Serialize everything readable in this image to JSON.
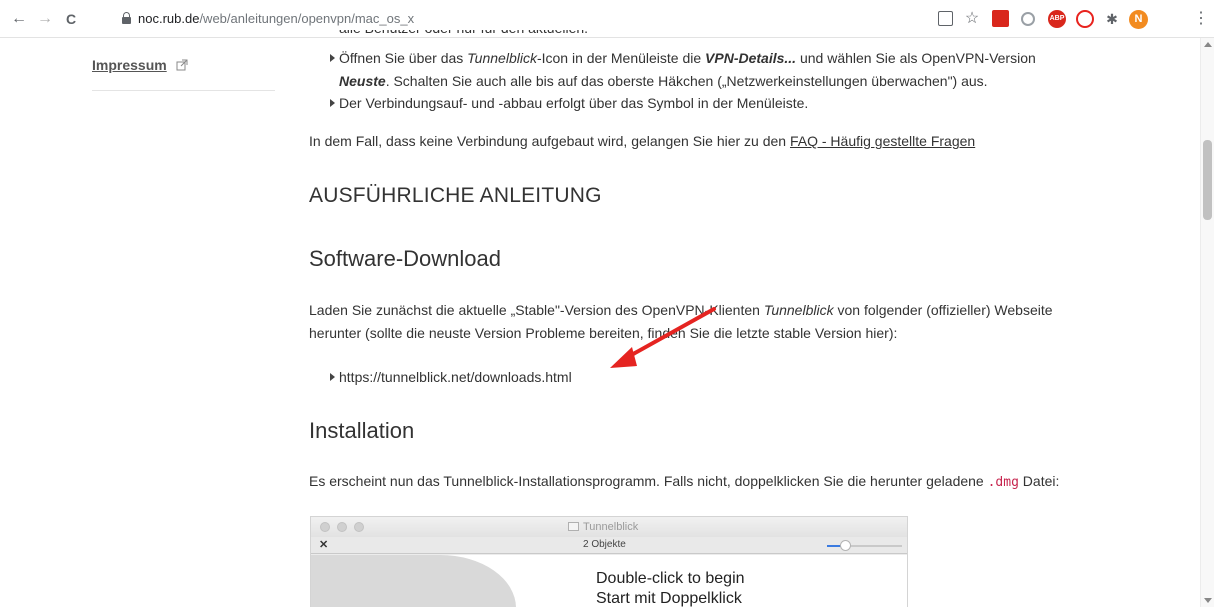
{
  "browser": {
    "url_host": "noc.rub.de",
    "url_path": "/web/anleitungen/openvpn/mac_os_x",
    "back_icon": "←",
    "forward_icon": "→",
    "reload_icon": "C",
    "star_icon": "☆",
    "menu_icon": "⋮",
    "profile_initial": "N",
    "abp_label": "ABP"
  },
  "sidebar": {
    "link_label": "Impressum"
  },
  "content": {
    "cut_line": "alle Benutzer oder nur für den aktuellen.",
    "bullets_top": [
      {
        "line1_a": "Öffnen Sie über das ",
        "line1_b": "Tunnelblick",
        "line1_c": "-Icon in der Menüleiste die ",
        "line1_d": "VPN-Details...",
        "line1_e": " und wählen Sie als OpenVPN-Version",
        "line2_a": "Neuste",
        "line2_b": ". Schalten Sie auch alle bis auf das oberste Häkchen („Netzwerkeinstellungen überwachen\") aus."
      },
      {
        "text": "Der Verbindungsauf- und -abbau erfolgt über das Symbol in der Menüleiste."
      }
    ],
    "faq_sentence": "In dem Fall, dass keine Verbindung aufgebaut wird, gelangen Sie hier zu den ",
    "faq_link": "FAQ - Häufig gestellte Fragen",
    "heading_main": "AUSFÜHRLICHE ANLEITUNG",
    "heading_download": "Software-Download",
    "download_line1_a": "Laden Sie zunächst die aktuelle „Stable\"-Version des OpenVPN-Klienten ",
    "download_line1_b": "Tunnelblick",
    "download_line1_c": " von folgender (offizieller) Webseite",
    "download_line2_a": "herunter (sollte die neuste Version Probleme bereiten, finden Sie die letzte stable Version ",
    "download_line2_link": "hier",
    "download_line2_b": "):",
    "download_link": "https://tunnelblick.net/downloads.html",
    "heading_install": "Installation",
    "install_a": "Es erscheint nun das Tunnelblick-Installationsprogramm. Falls nicht, doppelklicken Sie die herunter geladene ",
    "install_code": ".dmg",
    "install_b": " Datei:"
  },
  "finder": {
    "title": "Tunnelblick",
    "count": "2 Objekte",
    "tool_icon": "✕",
    "text1": "Double-click to begin",
    "text2": "Start mit Doppelklick"
  },
  "colors": {
    "arrow": "#e52421",
    "accent_blue": "#3b7be0"
  }
}
